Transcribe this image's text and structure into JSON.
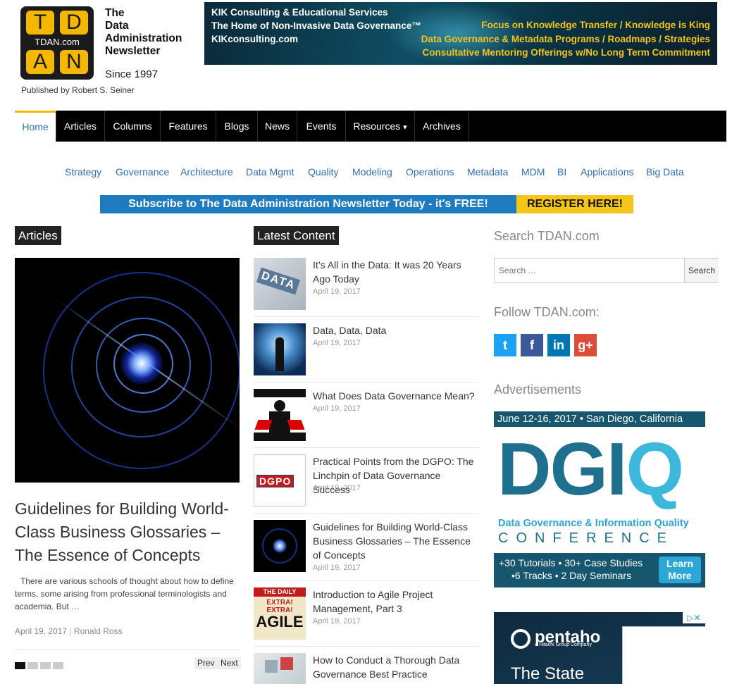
{
  "header": {
    "logo_letters": [
      "T",
      "D",
      "A",
      "N"
    ],
    "logo_mid": "TDAN.com",
    "brand_lines": [
      "The",
      "Data",
      "Administration",
      "Newsletter"
    ],
    "since": "Since 1997",
    "published": "Published by Robert S. Seiner"
  },
  "banner": {
    "left_lines": [
      "KIK Consulting & Educational Services",
      "The Home of Non-Invasive Data Governance™",
      "KIKconsulting.com"
    ],
    "right_lines": [
      "Focus on Knowledge Transfer / Knowledge is King",
      "Data Governance & Metadata Programs / Roadmaps / Strategies",
      "Consultative Mentoring Offerings w/No Long Term Commitment"
    ]
  },
  "nav": {
    "items": [
      "Home",
      "Articles",
      "Columns",
      "Features",
      "Blogs",
      "News",
      "Events",
      "Resources",
      "Archives"
    ],
    "resources_caret": "▾"
  },
  "subnav": [
    "Strategy",
    "Governance",
    "Architecture",
    "Data Mgmt",
    "Quality",
    "Modeling",
    "Operations",
    "Metadata",
    "MDM",
    "BI",
    "Applications",
    "Big Data"
  ],
  "subscribe": {
    "text": "Subscribe to The Data Administration Newsletter Today - it's FREE!",
    "cta": "REGISTER HERE!"
  },
  "articles": {
    "heading": "Articles",
    "feature": {
      "title": "Guidelines for Building World-Class Business Glossaries – The Essence of Concepts",
      "excerpt": "There are various schools of thought about how to define terms, some arising from professional terminologists and academia. But …",
      "date": "April 19, 2017",
      "separator": "|",
      "author": "Ronald Ross"
    },
    "slider_dots": 4,
    "prev": "Prev",
    "next": "Next"
  },
  "latest": {
    "heading": "Latest Content",
    "items": [
      {
        "title": "It’s All in the Data: It was 20 Years Ago Today",
        "date": "April 19, 2017",
        "thumb_text": "DATA"
      },
      {
        "title": "Data, Data, Data",
        "date": "April 19, 2017",
        "thumb_text": ""
      },
      {
        "title": "What Does Data Governance Mean?",
        "date": "April 19, 2017",
        "thumb_text": ""
      },
      {
        "title": "Practical Points from the DGPO: The Linchpin of Data Governance Success",
        "date": "April 19, 2017",
        "thumb_text": "DGPO"
      },
      {
        "title": "Guidelines for Building World-Class Business Glossaries – The Essence of Concepts",
        "date": "April 19, 2017",
        "thumb_text": ""
      },
      {
        "title": "Introduction to Agile Project Management, Part 3",
        "date": "April 19, 2017",
        "thumb_text": "AGILE"
      },
      {
        "title": "How to Conduct a Thorough Data Governance Best Practice Assessment",
        "date": "",
        "thumb_text": ""
      }
    ],
    "agile_thumb_top": "THE DAILY NEWS",
    "agile_thumb_mid": "EXTRA! EXTRA!"
  },
  "sidebar": {
    "search_heading": "Search TDAN.com",
    "search_placeholder": "Search …",
    "search_button": "Search",
    "follow_heading": "Follow TDAN.com:",
    "social": [
      {
        "name": "twitter-icon",
        "glyph": "t",
        "color": "#1da1f2"
      },
      {
        "name": "facebook-icon",
        "glyph": "f",
        "color": "#3b5998"
      },
      {
        "name": "linkedin-icon",
        "glyph": "in",
        "color": "#0077b5"
      },
      {
        "name": "googleplus-icon",
        "glyph": "g+",
        "color": "#dd4b39"
      }
    ],
    "ads_heading": "Advertisements",
    "dgiq": {
      "top": "June 12-16, 2017 • San Diego, California",
      "big_left": "DGI",
      "big_right": "Q",
      "sub1": "Data Governance & Information Quality",
      "sub2": "CONFERENCE",
      "line1": "+30 Tutorials • 30+ Case Studies",
      "line2": "•6 Tracks • 2 Day Seminars",
      "learn": "Learn More"
    },
    "pentaho": {
      "logo": "pentaho",
      "sub": "A Hitachi Group Company",
      "headline": "The State",
      "adchoice": "▷✕"
    }
  },
  "colors": {
    "accent_yellow": "#f5b800",
    "link_blue": "#2e6fb5",
    "nav_black": "#000000",
    "subscribe_blue": "#1f7bc0",
    "subscribe_yellow": "#f5c518"
  }
}
